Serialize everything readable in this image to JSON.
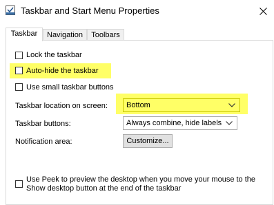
{
  "window": {
    "title": "Taskbar and Start Menu Properties"
  },
  "tabs": [
    {
      "label": "Taskbar"
    },
    {
      "label": "Navigation"
    },
    {
      "label": "Toolbars"
    }
  ],
  "options": {
    "lock": {
      "label": "Lock the taskbar",
      "checked": false
    },
    "autohide": {
      "label": "Auto-hide the taskbar",
      "checked": false
    },
    "small_buttons": {
      "label": "Use small taskbar buttons",
      "checked": false
    },
    "peek": {
      "line1": "Use Peek to preview the desktop when you move your mouse to the",
      "line2": "Show desktop button at the end of the taskbar",
      "checked": false
    }
  },
  "location": {
    "label": "Taskbar location on screen:",
    "value": "Bottom"
  },
  "buttons_setting": {
    "label": "Taskbar buttons:",
    "value": "Always combine, hide labels"
  },
  "notification": {
    "label": "Notification area:",
    "button": "Customize..."
  },
  "colors": {
    "highlight": "#ffff66"
  },
  "icons": {
    "app": "taskbar-properties-icon",
    "close": "close-icon",
    "dropdown": "chevron-down-icon"
  }
}
